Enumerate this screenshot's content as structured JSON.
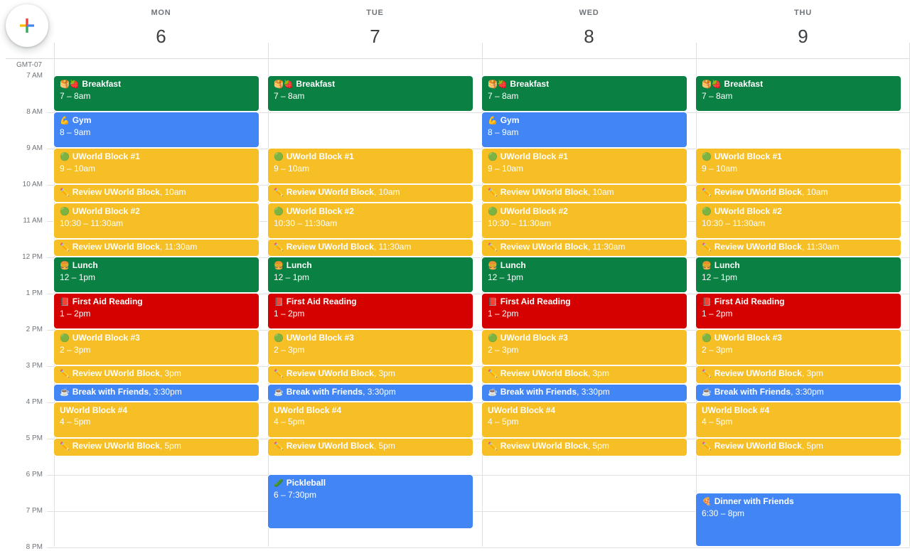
{
  "timezone": "GMT-07",
  "days": [
    {
      "name": "MON",
      "num": "6"
    },
    {
      "name": "TUE",
      "num": "7"
    },
    {
      "name": "WED",
      "num": "8"
    },
    {
      "name": "THU",
      "num": "9"
    }
  ],
  "hours": [
    "7 AM",
    "8 AM",
    "9 AM",
    "10 AM",
    "11 AM",
    "12 PM",
    "1 PM",
    "2 PM",
    "3 PM",
    "4 PM",
    "5 PM",
    "6 PM",
    "7 PM",
    "8 PM"
  ],
  "colors": {
    "green": "#0b8043",
    "blue": "#4285f4",
    "yellow": "#f6bf26",
    "red": "#d50000"
  },
  "columns": [
    {
      "events": [
        {
          "emoji": "🥞🍓",
          "title": "Breakfast",
          "time": "7 – 8am",
          "color": "green",
          "start": 7,
          "end": 8
        },
        {
          "emoji": "💪",
          "title": "Gym",
          "time": "8 – 9am",
          "color": "blue",
          "start": 8,
          "end": 9
        },
        {
          "emoji": "🟢",
          "title": "UWorld Block #1",
          "time": "9 – 10am",
          "color": "yellow",
          "start": 9,
          "end": 10
        },
        {
          "emoji": "✏️",
          "title": "Review UWorld Block",
          "time": ", 10am",
          "color": "yellow",
          "start": 10,
          "end": 10.5,
          "inline": true
        },
        {
          "emoji": "🟢",
          "title": "UWorld Block #2",
          "time": "10:30 – 11:30am",
          "color": "yellow",
          "start": 10.5,
          "end": 11.5
        },
        {
          "emoji": "✏️",
          "title": "Review UWorld Block",
          "time": ", 11:30am",
          "color": "yellow",
          "start": 11.5,
          "end": 12,
          "inline": true
        },
        {
          "emoji": "🍔",
          "title": "Lunch",
          "time": "12 – 1pm",
          "color": "green",
          "start": 12,
          "end": 13
        },
        {
          "emoji": "📕",
          "title": "First Aid Reading",
          "time": "1 – 2pm",
          "color": "red",
          "start": 13,
          "end": 14
        },
        {
          "emoji": "🟢",
          "title": "UWorld Block #3",
          "time": "2 – 3pm",
          "color": "yellow",
          "start": 14,
          "end": 15
        },
        {
          "emoji": "✏️",
          "title": "Review UWorld Block",
          "time": ", 3pm",
          "color": "yellow",
          "start": 15,
          "end": 15.5,
          "inline": true
        },
        {
          "emoji": "☕",
          "title": "Break with Friends",
          "time": ", 3:30pm",
          "color": "blue",
          "start": 15.5,
          "end": 16,
          "inline": true
        },
        {
          "emoji": "",
          "title": "UWorld Block #4",
          "time": "4 – 5pm",
          "color": "yellow",
          "start": 16,
          "end": 17
        },
        {
          "emoji": "✏️",
          "title": "Review UWorld Block",
          "time": ", 5pm",
          "color": "yellow",
          "start": 17,
          "end": 17.5,
          "inline": true
        }
      ]
    },
    {
      "events": [
        {
          "emoji": "🥞🍓",
          "title": "Breakfast",
          "time": "7 – 8am",
          "color": "green",
          "start": 7,
          "end": 8
        },
        {
          "emoji": "🟢",
          "title": "UWorld Block #1",
          "time": "9 – 10am",
          "color": "yellow",
          "start": 9,
          "end": 10
        },
        {
          "emoji": "✏️",
          "title": "Review UWorld Block",
          "time": ", 10am",
          "color": "yellow",
          "start": 10,
          "end": 10.5,
          "inline": true
        },
        {
          "emoji": "🟢",
          "title": "UWorld Block #2",
          "time": "10:30 – 11:30am",
          "color": "yellow",
          "start": 10.5,
          "end": 11.5
        },
        {
          "emoji": "✏️",
          "title": "Review UWorld Block",
          "time": ", 11:30am",
          "color": "yellow",
          "start": 11.5,
          "end": 12,
          "inline": true
        },
        {
          "emoji": "🍔",
          "title": "Lunch",
          "time": "12 – 1pm",
          "color": "green",
          "start": 12,
          "end": 13
        },
        {
          "emoji": "📕",
          "title": "First Aid Reading",
          "time": "1 – 2pm",
          "color": "red",
          "start": 13,
          "end": 14
        },
        {
          "emoji": "🟢",
          "title": "UWorld Block #3",
          "time": "2 – 3pm",
          "color": "yellow",
          "start": 14,
          "end": 15
        },
        {
          "emoji": "✏️",
          "title": "Review UWorld Block",
          "time": ", 3pm",
          "color": "yellow",
          "start": 15,
          "end": 15.5,
          "inline": true
        },
        {
          "emoji": "☕",
          "title": "Break with Friends",
          "time": ", 3:30pm",
          "color": "blue",
          "start": 15.5,
          "end": 16,
          "inline": true
        },
        {
          "emoji": "",
          "title": "UWorld Block #4",
          "time": "4 – 5pm",
          "color": "yellow",
          "start": 16,
          "end": 17
        },
        {
          "emoji": "✏️",
          "title": "Review UWorld Block",
          "time": ", 5pm",
          "color": "yellow",
          "start": 17,
          "end": 17.5,
          "inline": true
        },
        {
          "emoji": "🥒",
          "title": "Pickleball",
          "time": "6 – 7:30pm",
          "color": "blue",
          "start": 18,
          "end": 19.5
        }
      ]
    },
    {
      "events": [
        {
          "emoji": "🥞🍓",
          "title": "Breakfast",
          "time": "7 – 8am",
          "color": "green",
          "start": 7,
          "end": 8
        },
        {
          "emoji": "💪",
          "title": "Gym",
          "time": "8 – 9am",
          "color": "blue",
          "start": 8,
          "end": 9
        },
        {
          "emoji": "🟢",
          "title": "UWorld Block #1",
          "time": "9 – 10am",
          "color": "yellow",
          "start": 9,
          "end": 10
        },
        {
          "emoji": "✏️",
          "title": "Review UWorld Block",
          "time": ", 10am",
          "color": "yellow",
          "start": 10,
          "end": 10.5,
          "inline": true
        },
        {
          "emoji": "🟢",
          "title": "UWorld Block #2",
          "time": "10:30 – 11:30am",
          "color": "yellow",
          "start": 10.5,
          "end": 11.5
        },
        {
          "emoji": "✏️",
          "title": "Review UWorld Block",
          "time": ", 11:30am",
          "color": "yellow",
          "start": 11.5,
          "end": 12,
          "inline": true
        },
        {
          "emoji": "🍔",
          "title": "Lunch",
          "time": "12 – 1pm",
          "color": "green",
          "start": 12,
          "end": 13
        },
        {
          "emoji": "📕",
          "title": "First Aid Reading",
          "time": "1 – 2pm",
          "color": "red",
          "start": 13,
          "end": 14
        },
        {
          "emoji": "🟢",
          "title": "UWorld Block #3",
          "time": "2 – 3pm",
          "color": "yellow",
          "start": 14,
          "end": 15
        },
        {
          "emoji": "✏️",
          "title": "Review UWorld Block",
          "time": ", 3pm",
          "color": "yellow",
          "start": 15,
          "end": 15.5,
          "inline": true
        },
        {
          "emoji": "☕",
          "title": "Break with Friends",
          "time": ", 3:30pm",
          "color": "blue",
          "start": 15.5,
          "end": 16,
          "inline": true
        },
        {
          "emoji": "",
          "title": "UWorld Block #4",
          "time": "4 – 5pm",
          "color": "yellow",
          "start": 16,
          "end": 17
        },
        {
          "emoji": "✏️",
          "title": "Review UWorld Block",
          "time": ", 5pm",
          "color": "yellow",
          "start": 17,
          "end": 17.5,
          "inline": true
        }
      ]
    },
    {
      "events": [
        {
          "emoji": "🥞🍓",
          "title": "Breakfast",
          "time": "7 – 8am",
          "color": "green",
          "start": 7,
          "end": 8
        },
        {
          "emoji": "🟢",
          "title": "UWorld Block #1",
          "time": "9 – 10am",
          "color": "yellow",
          "start": 9,
          "end": 10
        },
        {
          "emoji": "✏️",
          "title": "Review UWorld Block",
          "time": ", 10am",
          "color": "yellow",
          "start": 10,
          "end": 10.5,
          "inline": true
        },
        {
          "emoji": "🟢",
          "title": "UWorld Block #2",
          "time": "10:30 – 11:30am",
          "color": "yellow",
          "start": 10.5,
          "end": 11.5
        },
        {
          "emoji": "✏️",
          "title": "Review UWorld Block",
          "time": ", 11:30am",
          "color": "yellow",
          "start": 11.5,
          "end": 12,
          "inline": true
        },
        {
          "emoji": "🍔",
          "title": "Lunch",
          "time": "12 – 1pm",
          "color": "green",
          "start": 12,
          "end": 13
        },
        {
          "emoji": "📕",
          "title": "First Aid Reading",
          "time": "1 – 2pm",
          "color": "red",
          "start": 13,
          "end": 14
        },
        {
          "emoji": "🟢",
          "title": "UWorld Block #3",
          "time": "2 – 3pm",
          "color": "yellow",
          "start": 14,
          "end": 15
        },
        {
          "emoji": "✏️",
          "title": "Review UWorld Block",
          "time": ", 3pm",
          "color": "yellow",
          "start": 15,
          "end": 15.5,
          "inline": true
        },
        {
          "emoji": "☕",
          "title": "Break with Friends",
          "time": ", 3:30pm",
          "color": "blue",
          "start": 15.5,
          "end": 16,
          "inline": true
        },
        {
          "emoji": "",
          "title": "UWorld Block #4",
          "time": "4 – 5pm",
          "color": "yellow",
          "start": 16,
          "end": 17
        },
        {
          "emoji": "✏️",
          "title": "Review UWorld Block",
          "time": ", 5pm",
          "color": "yellow",
          "start": 17,
          "end": 17.5,
          "inline": true
        },
        {
          "emoji": "🍕",
          "title": "Dinner with Friends",
          "time": "6:30 – 8pm",
          "color": "blue",
          "start": 18.5,
          "end": 20
        }
      ]
    }
  ]
}
